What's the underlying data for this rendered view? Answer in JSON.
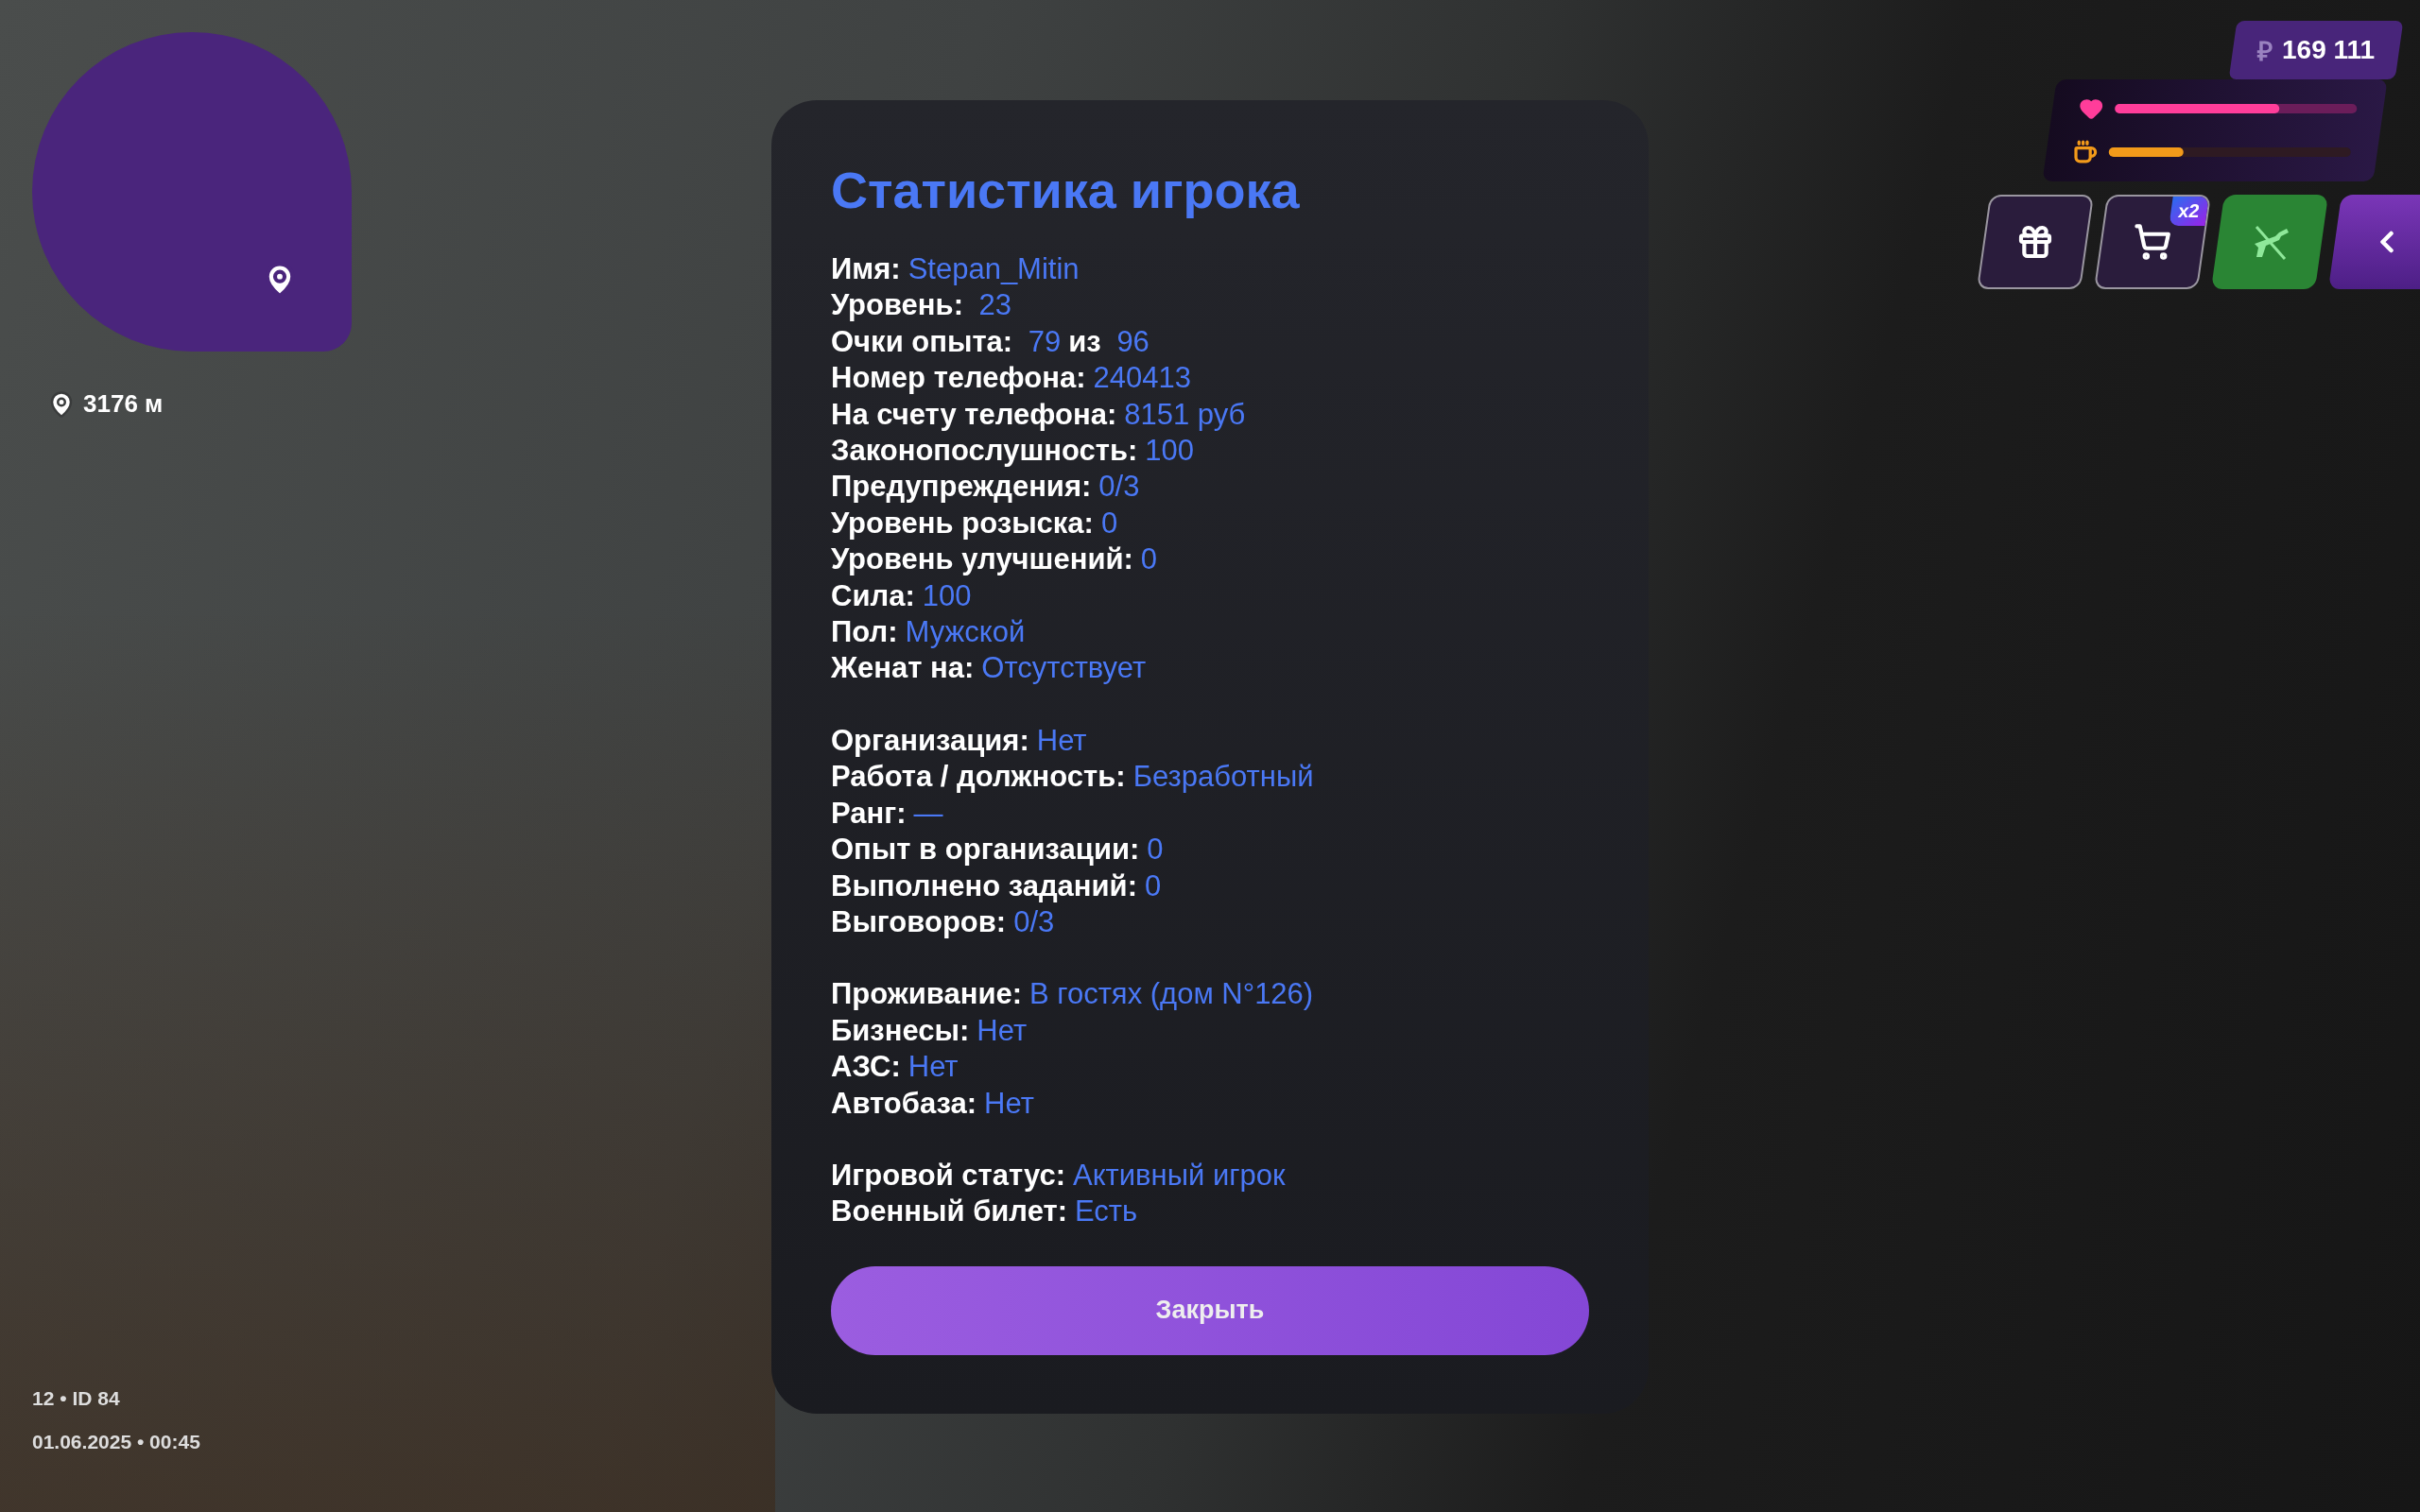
{
  "minimap": {
    "distance": "3176 м"
  },
  "hud": {
    "currency_symbol": "₽",
    "money": "169 111",
    "health": {
      "level": 0.68
    },
    "hunger": {
      "level": 0.31
    },
    "buttons": [
      {
        "kind": "gift"
      },
      {
        "kind": "cart",
        "badge": "x2"
      },
      {
        "kind": "weapon"
      },
      {
        "kind": "collapse"
      }
    ]
  },
  "dialog": {
    "title": "Статистика игрока",
    "sections": [
      [
        {
          "parts": [
            {
              "text": "Имя:",
              "accent": false
            },
            {
              "text": "Stepan_Mitin",
              "accent": true
            }
          ]
        },
        {
          "parts": [
            {
              "text": "Уровень:",
              "accent": false
            },
            {
              "text": " 23",
              "accent": true
            }
          ]
        },
        {
          "parts": [
            {
              "text": "Очки опыта:",
              "accent": false
            },
            {
              "text": " 79",
              "accent": true
            },
            {
              "text": "из",
              "accent": false
            },
            {
              "text": " 96",
              "accent": true
            }
          ]
        },
        {
          "parts": [
            {
              "text": "Номер телефона:",
              "accent": false
            },
            {
              "text": "240413",
              "accent": true
            }
          ]
        },
        {
          "parts": [
            {
              "text": "На счету телефона:",
              "accent": false
            },
            {
              "text": "8151 руб",
              "accent": true
            }
          ]
        },
        {
          "parts": [
            {
              "text": "Законопослушность:",
              "accent": false
            },
            {
              "text": "100",
              "accent": true
            }
          ]
        },
        {
          "parts": [
            {
              "text": "Предупреждения:",
              "accent": false
            },
            {
              "text": "0/3",
              "accent": true
            }
          ]
        },
        {
          "parts": [
            {
              "text": "Уровень розыска:",
              "accent": false
            },
            {
              "text": "0",
              "accent": true
            }
          ]
        },
        {
          "parts": [
            {
              "text": "Уровень улучшений:",
              "accent": false
            },
            {
              "text": "0",
              "accent": true
            }
          ]
        },
        {
          "parts": [
            {
              "text": "Сила:",
              "accent": false
            },
            {
              "text": "100",
              "accent": true
            }
          ]
        },
        {
          "parts": [
            {
              "text": "Пол:",
              "accent": false
            },
            {
              "text": "Мужской",
              "accent": true
            }
          ]
        },
        {
          "parts": [
            {
              "text": "Женат на:",
              "accent": false
            },
            {
              "text": "Отсутствует",
              "accent": true
            }
          ]
        }
      ],
      [
        {
          "parts": [
            {
              "text": "Организация:",
              "accent": false
            },
            {
              "text": "Нет",
              "accent": true
            }
          ]
        },
        {
          "parts": [
            {
              "text": "Работа / должность:",
              "accent": false
            },
            {
              "text": "Безработный",
              "accent": true
            }
          ]
        },
        {
          "parts": [
            {
              "text": "Ранг:",
              "accent": false
            },
            {
              "text": "—",
              "accent": true
            }
          ]
        },
        {
          "parts": [
            {
              "text": "Опыт в организации:",
              "accent": false
            },
            {
              "text": "0",
              "accent": true
            }
          ]
        },
        {
          "parts": [
            {
              "text": "Выполнено заданий:",
              "accent": false
            },
            {
              "text": "0",
              "accent": true
            }
          ]
        },
        {
          "parts": [
            {
              "text": "Выговоров:",
              "accent": false
            },
            {
              "text": "0/3",
              "accent": true
            }
          ]
        }
      ],
      [
        {
          "parts": [
            {
              "text": "Проживание:",
              "accent": false
            },
            {
              "text": "В гостях (дом N°126)",
              "accent": true
            }
          ]
        },
        {
          "parts": [
            {
              "text": "Бизнесы:",
              "accent": false
            },
            {
              "text": "Нет",
              "accent": true
            }
          ]
        },
        {
          "parts": [
            {
              "text": "АЗС:",
              "accent": false
            },
            {
              "text": "Нет",
              "accent": true
            }
          ]
        },
        {
          "parts": [
            {
              "text": "Автобаза:",
              "accent": false
            },
            {
              "text": "Нет",
              "accent": true
            }
          ]
        }
      ],
      [
        {
          "parts": [
            {
              "text": "Игровой статус:",
              "accent": false
            },
            {
              "text": "Активный игрок",
              "accent": true
            }
          ]
        },
        {
          "parts": [
            {
              "text": "Военный билет:",
              "accent": false
            },
            {
              "text": "Есть",
              "accent": true
            }
          ]
        }
      ]
    ],
    "close_button": "Закрыть"
  },
  "footer": {
    "server_line": "12 • ID 84",
    "datetime": "01.06.2025 • 00:45"
  }
}
